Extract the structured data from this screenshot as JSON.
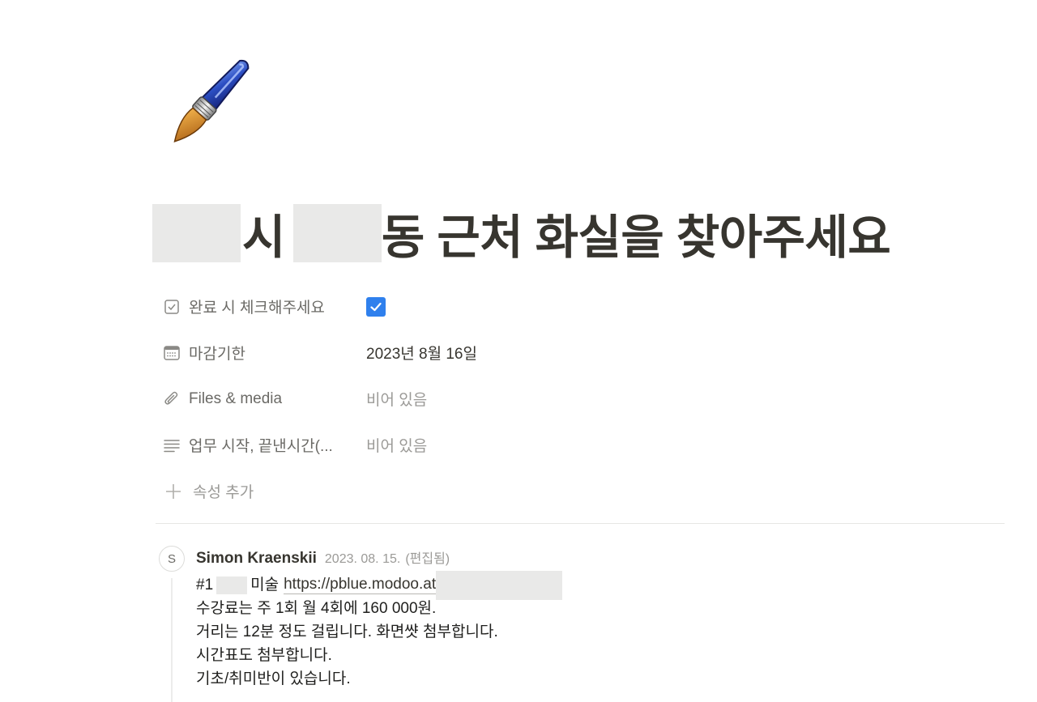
{
  "page": {
    "icon": "paintbrush-icon",
    "title_part1": "시",
    "title_part2": "동 근처 화실을 찾아주세요"
  },
  "properties": [
    {
      "icon": "checkbox-icon",
      "name": "완료 시 체크해주세요",
      "value_type": "checkbox",
      "checked": true
    },
    {
      "icon": "calendar-icon",
      "name": "마감기한",
      "value": "2023년 8월 16일"
    },
    {
      "icon": "paperclip-icon",
      "name": "Files & media",
      "value": "비어 있음"
    },
    {
      "icon": "text-lines-icon",
      "name": "업무 시작, 끝낸시간(...",
      "value": "비어 있음"
    }
  ],
  "add_property": {
    "icon": "plus-icon",
    "label": "속성 추가"
  },
  "comment": {
    "avatar_initial": "S",
    "author": "Simon Kraenskii",
    "date": "2023. 08. 15.",
    "edited": "(편집됨)",
    "line1_prefix": "#1",
    "line1_word": "미술",
    "link": "https://pblue.modoo.at",
    "lines": [
      "수강료는 주 1회 월 4회에 160 000원.",
      "거리는 12분 정도 걸립니다. 화면썃 첨부합니다.",
      "시간표도 첨부합니다.",
      "기초/취미반이 있습니다."
    ]
  },
  "colors": {
    "checkbox": "#2f80ed",
    "redaction": "#e9e9e8",
    "text": "#37352f",
    "muted": "#9b9a97"
  }
}
